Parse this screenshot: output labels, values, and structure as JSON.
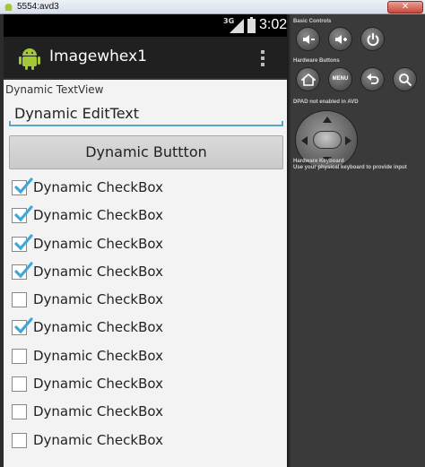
{
  "window": {
    "title": "5554:avd3"
  },
  "statusbar": {
    "network": "3G",
    "time": "3:02"
  },
  "actionbar": {
    "title": "Imagewhex1"
  },
  "content": {
    "textview": "Dynamic TextView",
    "edittext": "Dynamic EditText",
    "button": "Dynamic Buttton",
    "checkboxes": [
      {
        "label": "Dynamic CheckBox",
        "checked": true
      },
      {
        "label": "Dynamic CheckBox",
        "checked": true
      },
      {
        "label": "Dynamic CheckBox",
        "checked": true
      },
      {
        "label": "Dynamic CheckBox",
        "checked": true
      },
      {
        "label": "Dynamic CheckBox",
        "checked": false
      },
      {
        "label": "Dynamic CheckBox",
        "checked": true
      },
      {
        "label": "Dynamic CheckBox",
        "checked": false
      },
      {
        "label": "Dynamic CheckBox",
        "checked": false
      },
      {
        "label": "Dynamic CheckBox",
        "checked": false
      },
      {
        "label": "Dynamic CheckBox",
        "checked": false
      }
    ]
  },
  "panel": {
    "basic_controls": "Basic Controls",
    "hardware_buttons": "Hardware Buttons",
    "menu_label": "MENU",
    "dpad_label": "DPAD not enabled in AVD",
    "keyboard_title": "Hardware Keyboard",
    "keyboard_desc": "Use your physical keyboard to provide input"
  },
  "colors": {
    "accent": "#33b5e5",
    "check": "#3fa8d8",
    "actionbar": "#202020"
  }
}
